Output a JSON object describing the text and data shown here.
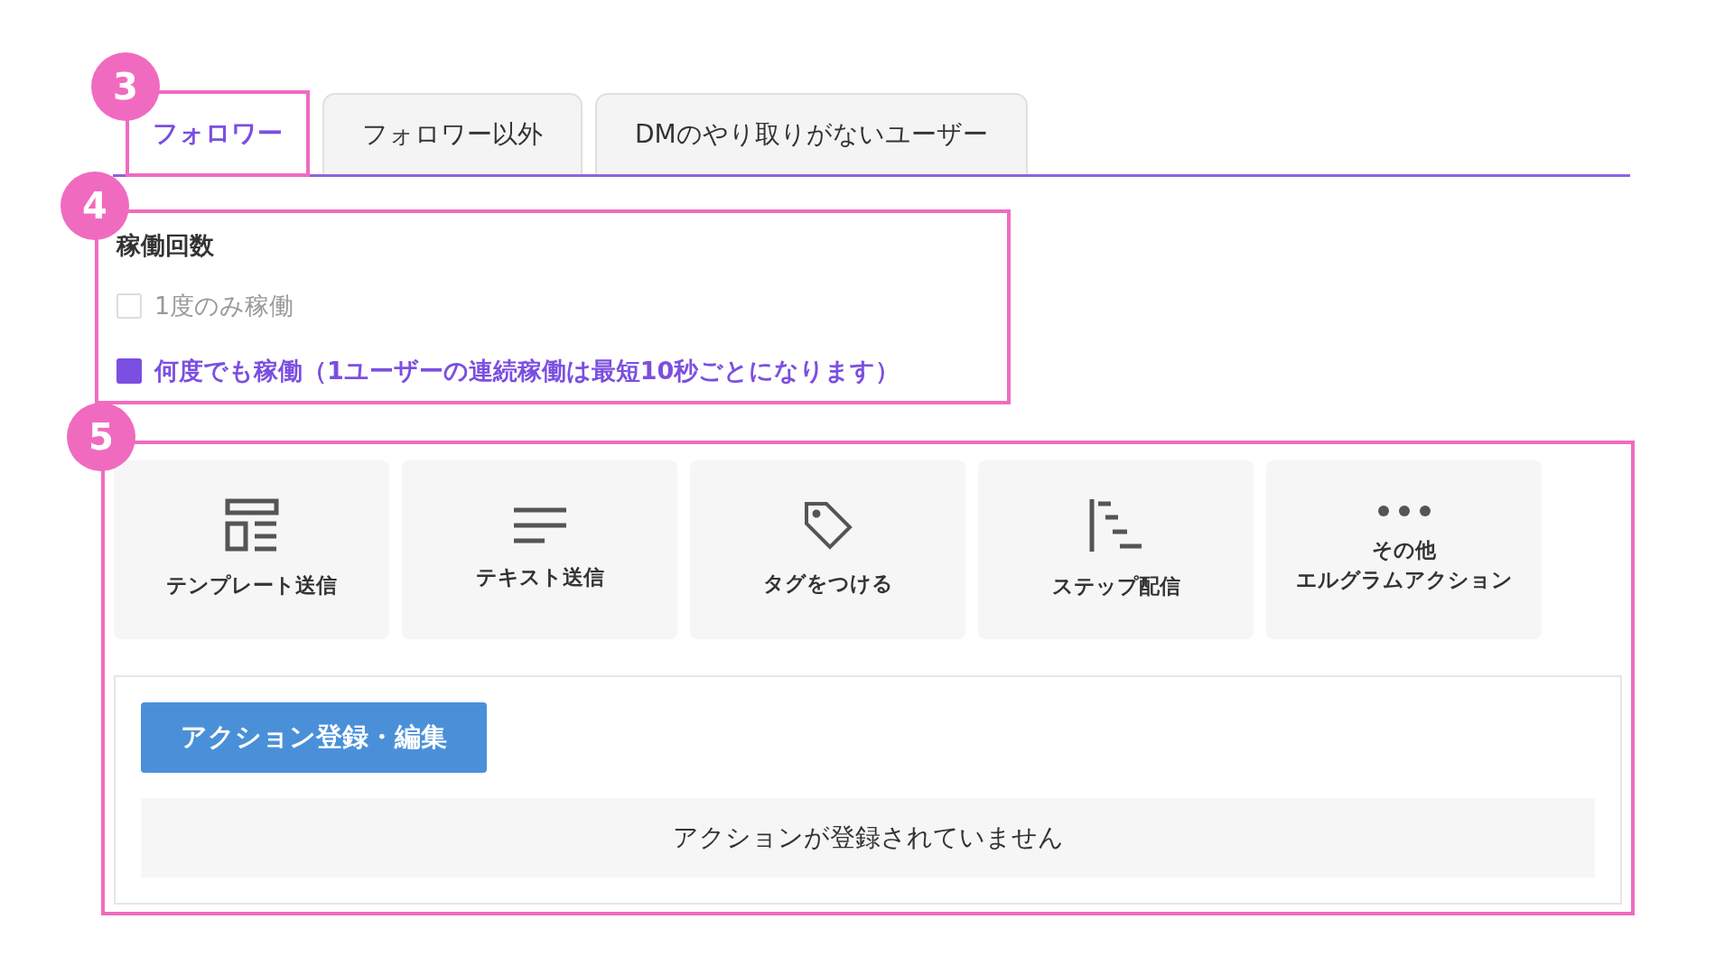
{
  "tabs": [
    {
      "label": "フォロワー",
      "selected": true,
      "callout": "3"
    },
    {
      "label": "フォロワー以外",
      "selected": false
    },
    {
      "label": "DMのやり取りがないユーザー",
      "selected": false
    }
  ],
  "run_count": {
    "callout": "4",
    "heading": "稼働回数",
    "options": [
      {
        "label": "1度のみ稼働",
        "checked": false
      },
      {
        "label": "何度でも稼働（1ユーザーの連続稼働は最短10秒ごとになります）",
        "checked": true
      }
    ]
  },
  "actions": {
    "callout": "5",
    "tiles": [
      {
        "kind": "template",
        "label_lines": [
          "テンプレート送信"
        ]
      },
      {
        "kind": "text",
        "label_lines": [
          "テキスト送信"
        ]
      },
      {
        "kind": "tag",
        "label_lines": [
          "タグをつける"
        ]
      },
      {
        "kind": "step",
        "label_lines": [
          "ステップ配信"
        ]
      },
      {
        "kind": "more",
        "label_lines": [
          "その他",
          "エルグラムアクション"
        ]
      }
    ],
    "button": "アクション登録・編集",
    "empty_message": "アクションが登録されていません"
  }
}
